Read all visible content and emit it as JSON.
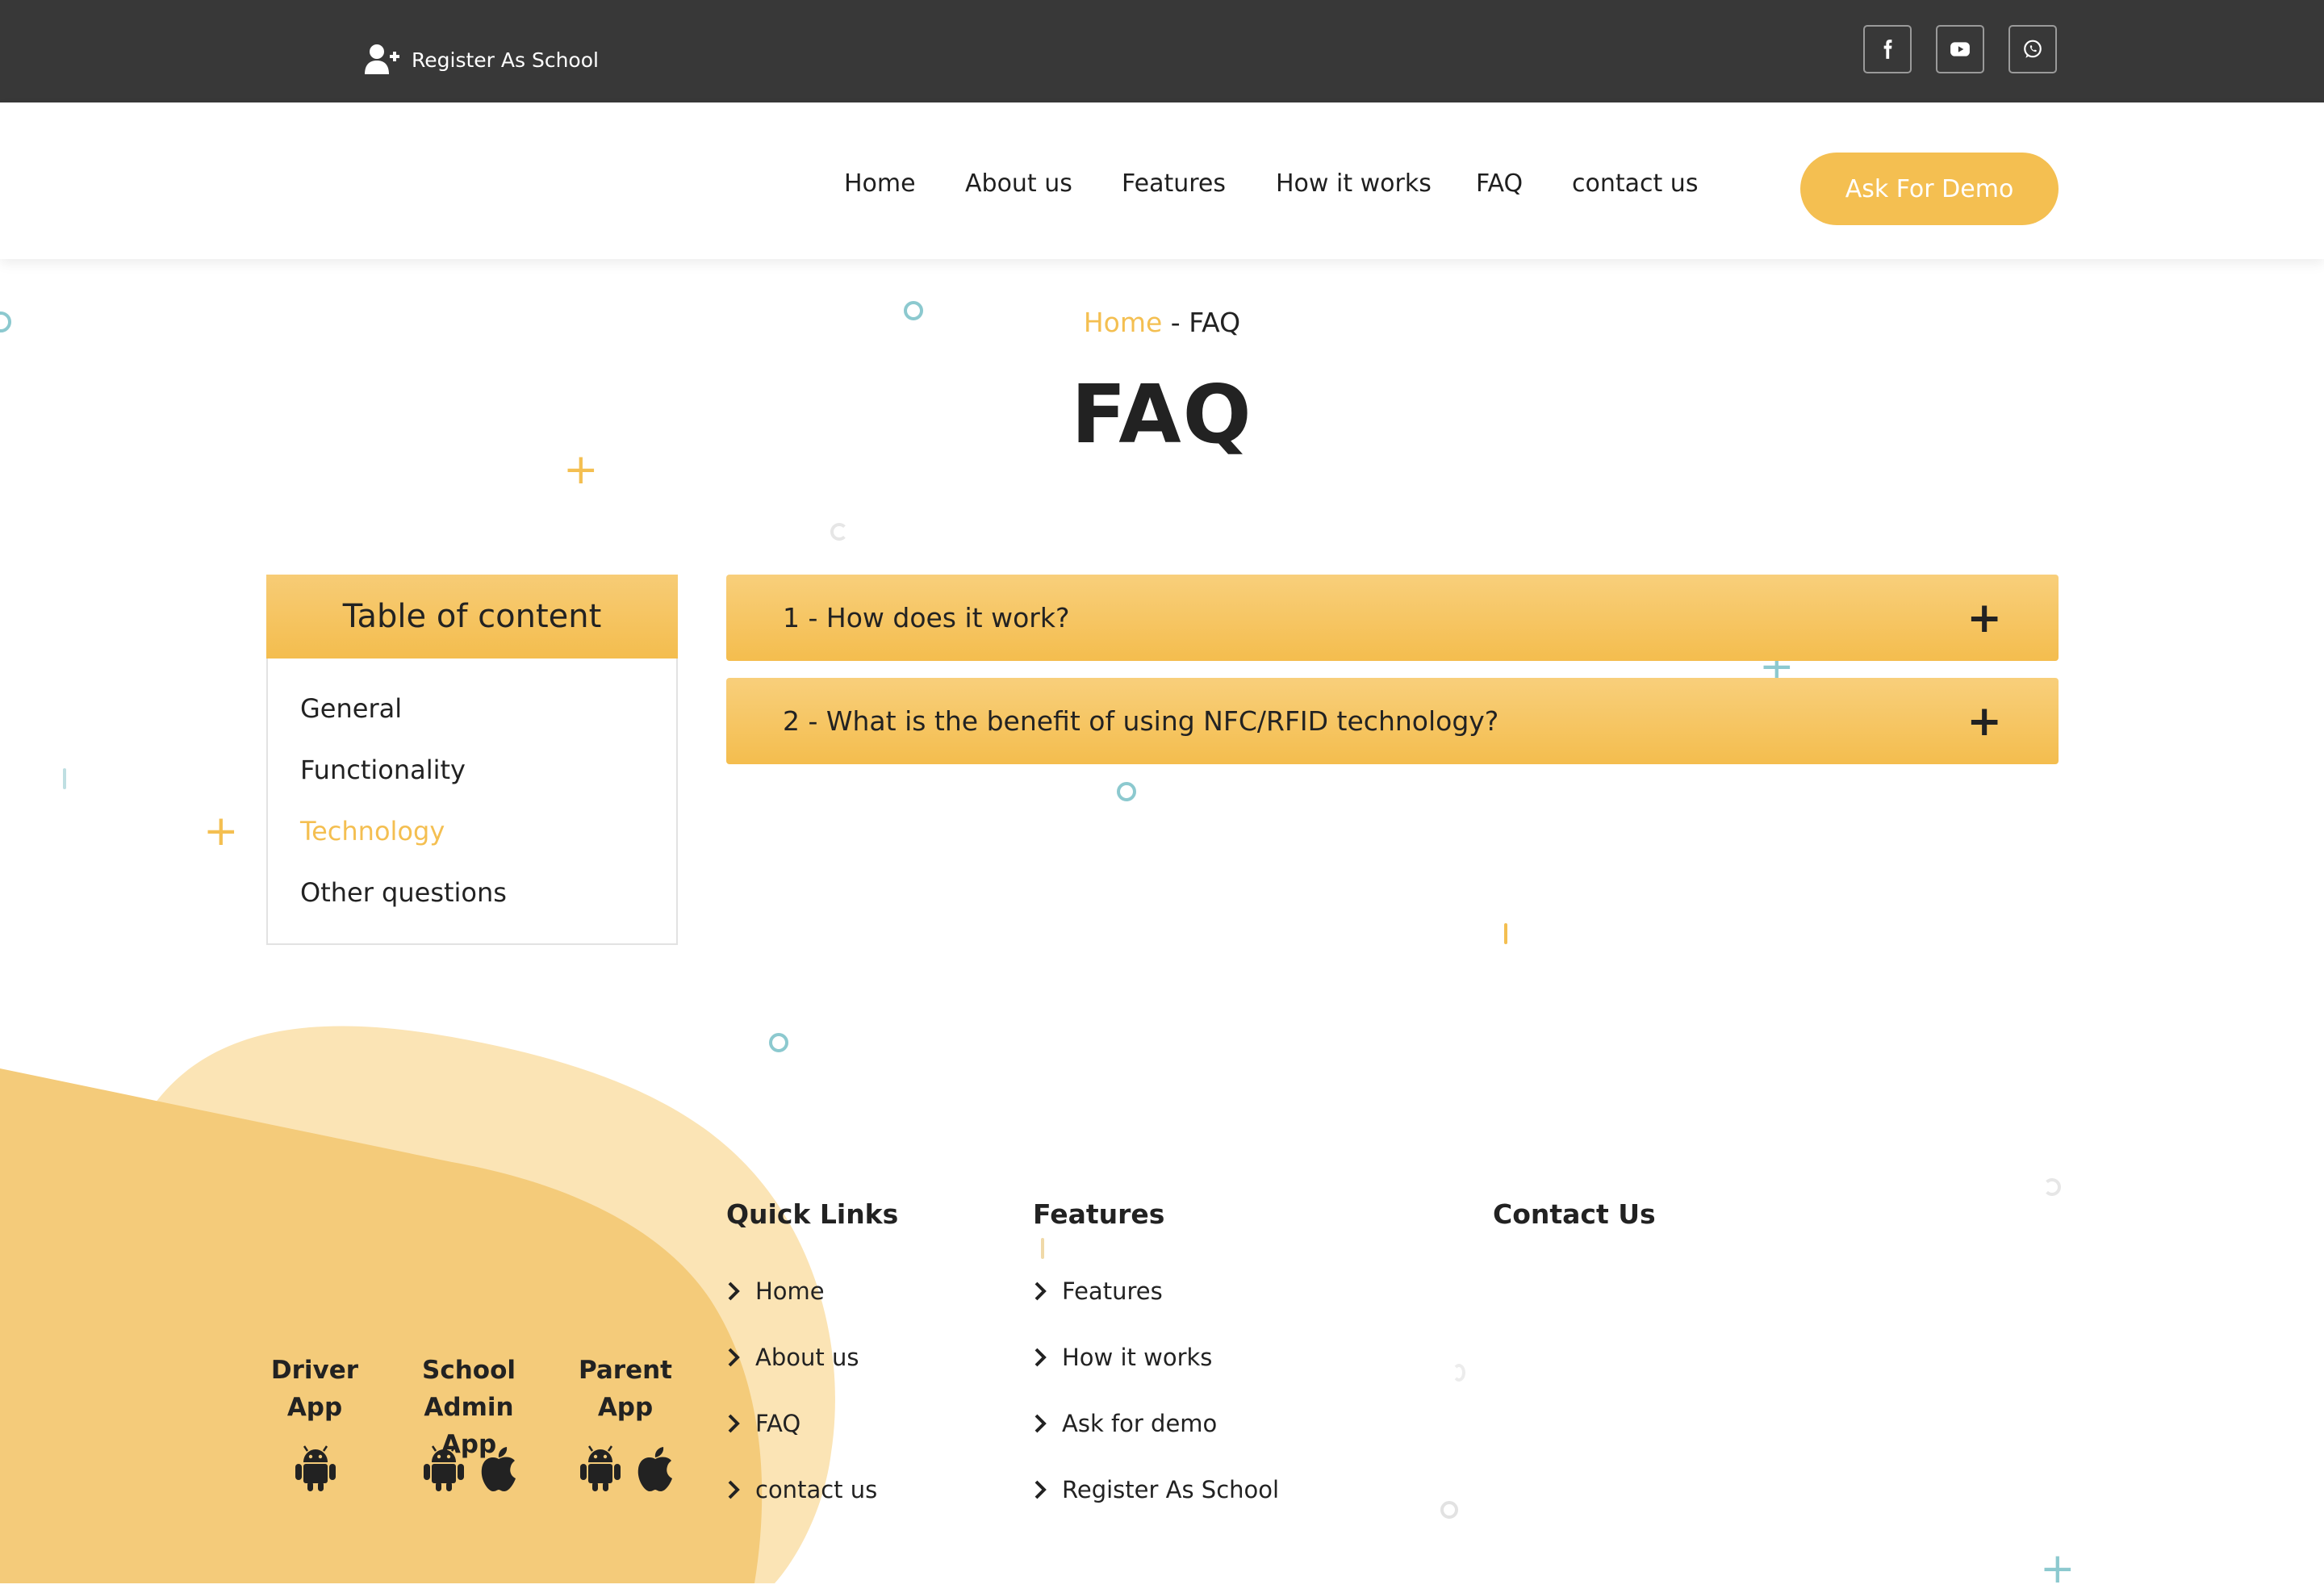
{
  "topbar": {
    "register_label": "Register As School",
    "social": [
      {
        "icon": "facebook-icon"
      },
      {
        "icon": "youtube-icon"
      },
      {
        "icon": "whatsapp-icon"
      }
    ]
  },
  "nav": {
    "items": [
      "Home",
      "About us",
      "Features",
      "How it works",
      "FAQ",
      "contact us"
    ],
    "demo_button": "Ask For Demo"
  },
  "breadcrumb": {
    "home": "Home",
    "separator": " - ",
    "current": "FAQ"
  },
  "page_title": "FAQ",
  "toc": {
    "title": "Table of content",
    "items": [
      "General",
      "Functionality",
      "Technology",
      "Other questions"
    ],
    "active": "Technology"
  },
  "faq": {
    "items": [
      "1 - How does it work?",
      "2 - What is the benefit of using NFC/RFID technology?"
    ]
  },
  "footer": {
    "apps": [
      {
        "line1": "Driver",
        "line2": "App",
        "platforms": [
          "android"
        ]
      },
      {
        "line1": "School Admin",
        "line2": "App",
        "platforms": [
          "android",
          "apple"
        ]
      },
      {
        "line1": "Parent",
        "line2": "App",
        "platforms": [
          "android",
          "apple"
        ]
      }
    ],
    "quick_links": {
      "title": "Quick Links",
      "items": [
        "Home",
        "About us",
        "FAQ",
        "contact us"
      ]
    },
    "features": {
      "title": "Features",
      "items": [
        "Features",
        "How it works",
        "Ask for demo",
        "Register As School"
      ]
    },
    "contact": {
      "title": "Contact Us"
    }
  },
  "colors": {
    "accent": "#f4bf51",
    "topbar": "#383838",
    "decor_teal": "#8cc9cf",
    "text": "#222222"
  }
}
